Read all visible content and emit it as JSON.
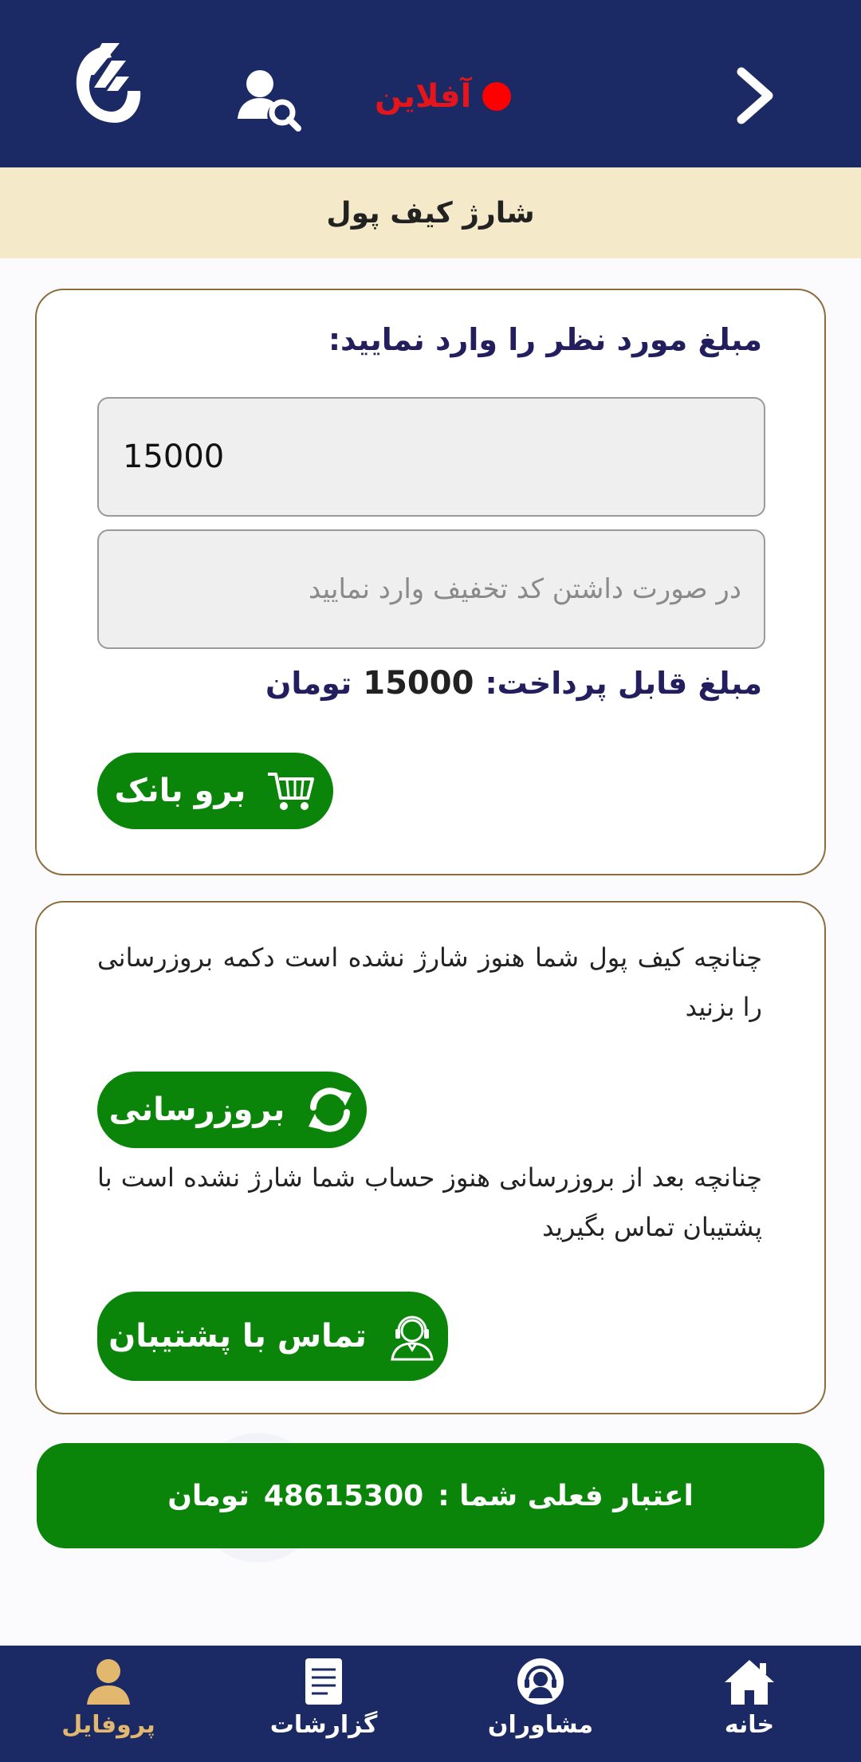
{
  "header": {
    "status_label": "آفلاین",
    "colors": {
      "bar": "#1b2a64",
      "status": "#e4151b"
    }
  },
  "page_title": "شارژ کیف پول",
  "charge_card": {
    "heading": "مبلغ مورد نظر را وارد نمایید:",
    "amount_value": "15000",
    "discount_placeholder": "در صورت داشتن کد تخفیف وارد نمایید",
    "payable_label": "مبلغ قابل پرداخت:",
    "payable_amount": "15000",
    "payable_unit": "تومان",
    "bank_button_label": "برو بانک"
  },
  "help_card": {
    "refresh_hint": "چنانچه کیف پول شما هنوز شارژ نشده است دکمه بروزرسانی را بزنید",
    "refresh_button_label": "بروزرسانی",
    "support_hint": "چنانچه بعد از بروزرسانی هنوز حساب شما شارژ نشده است با پشتیبان تماس بگیرید",
    "support_button_label": "تماس با پشتیبان"
  },
  "credit": {
    "label": "اعتبار فعلی شما :",
    "amount": "48615300",
    "unit": "تومان"
  },
  "bottom_nav": {
    "items": [
      {
        "label": "خانه",
        "icon": "home-icon"
      },
      {
        "label": "مشاوران",
        "icon": "headset-icon"
      },
      {
        "label": "گزارشات",
        "icon": "document-icon"
      },
      {
        "label": "پروفایل",
        "icon": "user-icon"
      }
    ],
    "active": "پروفایل",
    "colors": {
      "bar": "#1b2a64",
      "active": "#e2b76e"
    }
  },
  "accent_color": "#0b8509"
}
